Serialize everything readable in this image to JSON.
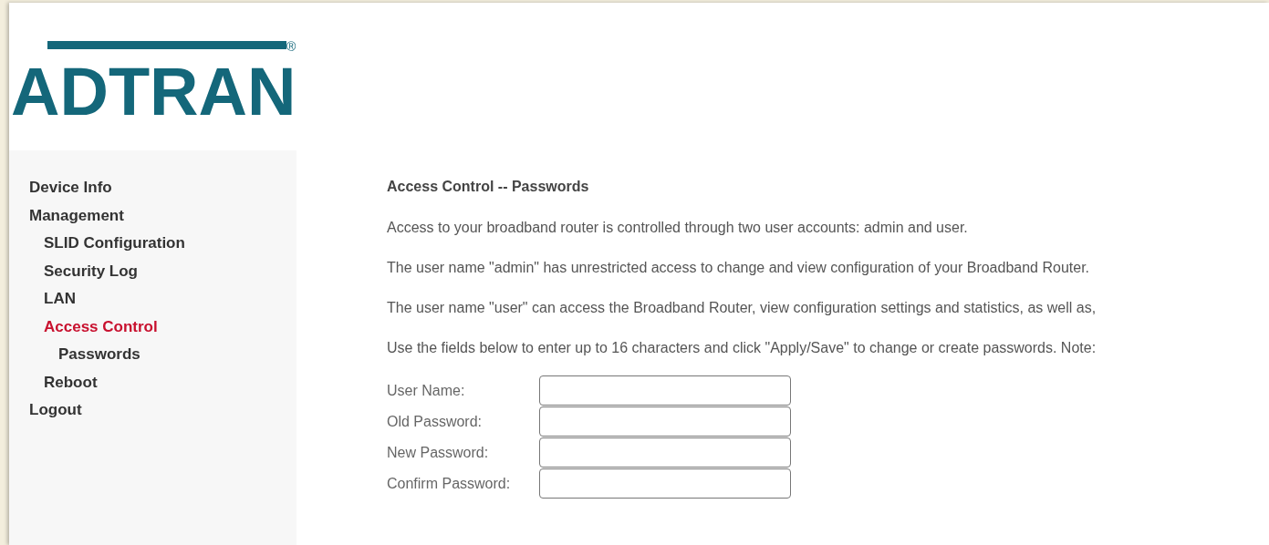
{
  "logo": {
    "text": "ADTRAN",
    "mark": "®"
  },
  "sidebar": {
    "items": [
      {
        "label": "Device Info",
        "selected": false
      },
      {
        "label": "Management",
        "selected": false,
        "children": [
          {
            "label": "SLID Configuration",
            "selected": false
          },
          {
            "label": "Security Log",
            "selected": false
          },
          {
            "label": "LAN",
            "selected": false
          },
          {
            "label": "Access Control",
            "selected": true,
            "children": [
              {
                "label": "Passwords",
                "selected": false
              }
            ]
          },
          {
            "label": "Reboot",
            "selected": false
          }
        ]
      },
      {
        "label": "Logout",
        "selected": false
      }
    ]
  },
  "main": {
    "title": "Access Control -- Passwords",
    "paragraphs": [
      "Access to your broadband router is controlled through two user accounts: admin and user.",
      "The user name \"admin\" has unrestricted access to change and view configuration of your Broadband Router.",
      "The user name \"user\" can access the Broadband Router, view configuration settings and statistics, as well as,",
      "Use the fields below to enter up to 16 characters and click \"Apply/Save\" to change or create passwords. Note:"
    ],
    "fields": [
      {
        "label": "User Name:"
      },
      {
        "label": "Old Password:"
      },
      {
        "label": "New Password:"
      },
      {
        "label": "Confirm Password:"
      }
    ]
  }
}
